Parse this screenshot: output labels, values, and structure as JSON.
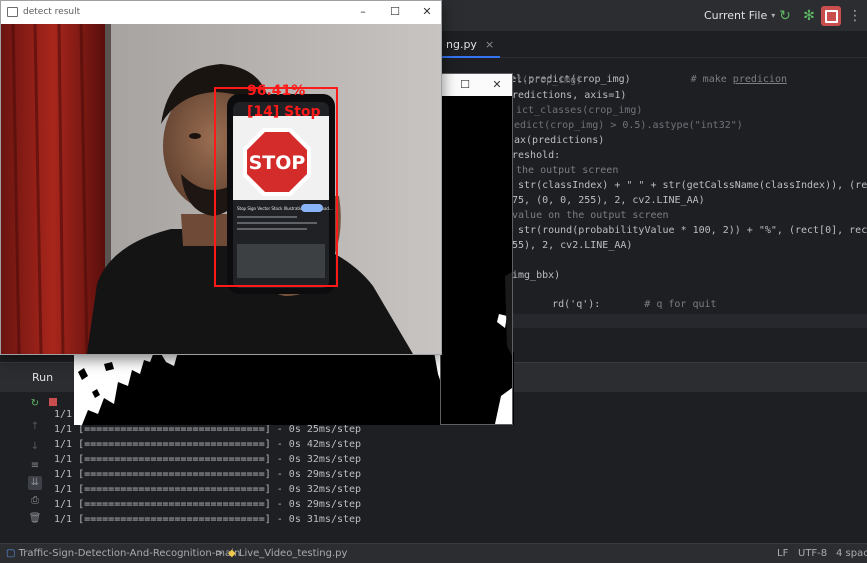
{
  "ide": {
    "toolbar": {
      "run_config": "Current File",
      "run_config_chevron": "chevron-down-icon",
      "run_icon": "rerun-icon",
      "debug_icon": "debug-bug-icon",
      "stop_icon": "stop-icon",
      "more_icon": "more-vertical-icon"
    },
    "editor": {
      "tab_label": "ng.py",
      "tab_close": "×",
      "lines": [
        {
          "text": "= model.predict(crop_img)",
          "comment": "# make ",
          "comment_u": "predicion"
        },
        {
          "text": "t(crop_img)"
        },
        {
          "text": "redictions, axis=1)"
        },
        {
          "text": "ict_classes(crop_img)"
        },
        {
          "text": "edict(crop_img) > 0.5).astype(\"int32\")"
        },
        {
          "text": "ax(predictions)"
        },
        {
          "text": "reshold:"
        },
        {
          "text": "the output screen"
        },
        {
          "text": " str(classIndex) + \" \" + str(getCalssName(classIndex)), (rect[0],"
        },
        {
          "text": "75, (0, 0, 255), 2, cv2.LINE_AA)"
        },
        {
          "text": "value on the output screen"
        },
        {
          "text": " str(round(probabilityValue * 100, 2)) + \"%\", (rect[0], rect[1] -"
        },
        {
          "text": "55), 2, cv2.LINE_AA)"
        },
        {
          "text": ""
        },
        {
          "text": "img_bbx)"
        },
        {
          "text": "rd('q'):",
          "comment": "# q for quit"
        }
      ]
    },
    "run": {
      "title": "Run",
      "console": [
        "1/1",
        "1/1 [==============================] - 0s 25ms/step",
        "1/1 [==============================] - 0s 42ms/step",
        "1/1 [==============================] - 0s 32ms/step",
        "1/1 [==============================] - 0s 29ms/step",
        "1/1 [==============================] - 0s 32ms/step",
        "1/1 [==============================] - 0s 29ms/step",
        "1/1 [==============================] - 0s 31ms/step"
      ]
    },
    "status_bar": {
      "project": "Traffic-Sign-Detection-And-Recognition-main",
      "separator": ">",
      "file": "Live_Video_testing.py",
      "line_ending": "LF",
      "encoding": "UTF-8",
      "indent": "4 spac"
    }
  },
  "detect_window": {
    "title": "detect result",
    "minimize": "–",
    "maximize": "☐",
    "close": "✕",
    "probability_label": "96.41%",
    "class_label": "[14] Stop",
    "phone_sign_text": "STOP",
    "phone_caption": "Stop Sign Vector Stock Illustration - Download..."
  },
  "binary_window": {
    "maximize": "☐",
    "close": "✕"
  },
  "colors": {
    "ide_bg": "#1e1f22",
    "panel_bg": "#2b2d30",
    "detection_red": "#ff1a1a",
    "stop_red": "#d42b2b",
    "accent_blue": "#3574f0"
  }
}
